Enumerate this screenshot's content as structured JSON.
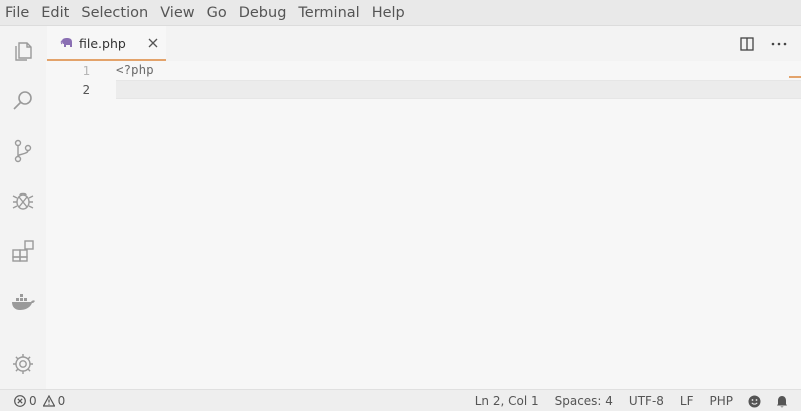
{
  "menu": [
    "File",
    "Edit",
    "Selection",
    "View",
    "Go",
    "Debug",
    "Terminal",
    "Help"
  ],
  "activity_bar": [
    "explorer-icon",
    "search-icon",
    "source-control-icon",
    "debug-icon",
    "extensions-icon",
    "docker-icon",
    "settings-gear-icon"
  ],
  "tab": {
    "label": "file.php",
    "icon": "php-elephant-icon",
    "active_border_color": "#e3a36b"
  },
  "editor_actions": [
    "split-editor-icon",
    "more-actions-icon"
  ],
  "editor": {
    "lines": [
      {
        "number": "1",
        "text": "<?php"
      },
      {
        "number": "2",
        "text": ""
      }
    ],
    "current_line": 2
  },
  "status": {
    "errors": "0",
    "warnings": "0",
    "position": "Ln 2, Col 1",
    "spaces": "Spaces: 4",
    "encoding": "UTF-8",
    "eol": "LF",
    "language": "PHP"
  }
}
